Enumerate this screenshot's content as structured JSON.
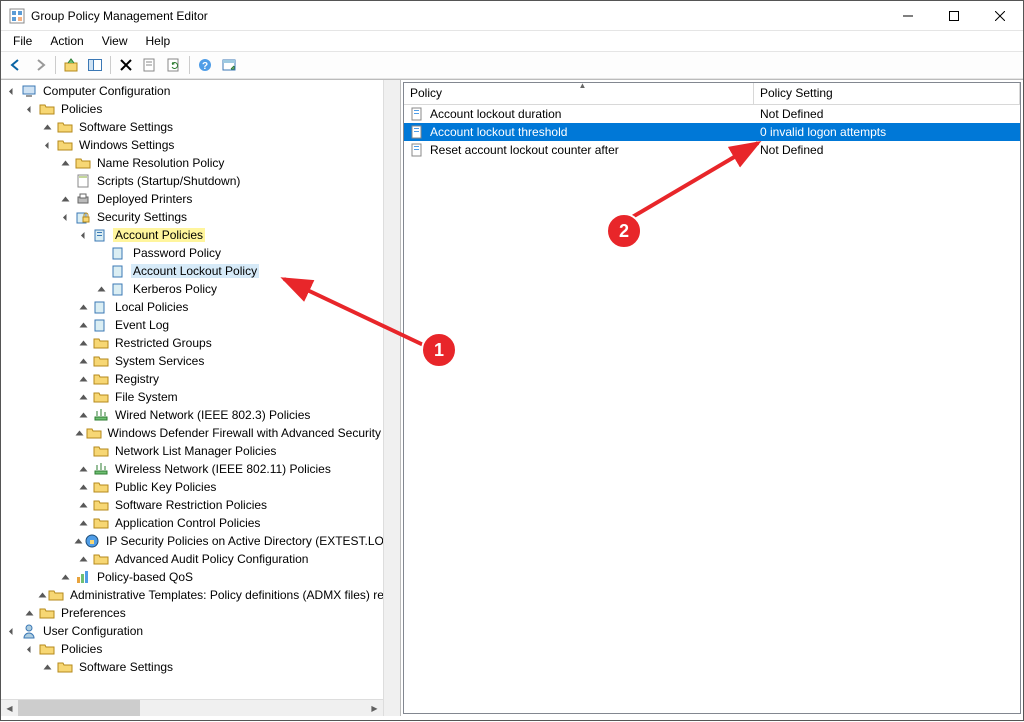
{
  "window": {
    "title": "Group Policy Management Editor"
  },
  "menus": [
    "File",
    "Action",
    "View",
    "Help"
  ],
  "tree": {
    "root": "Computer Configuration",
    "policies": "Policies",
    "software_settings": "Software Settings",
    "windows_settings": "Windows Settings",
    "name_resolution": "Name Resolution Policy",
    "scripts": "Scripts (Startup/Shutdown)",
    "deployed_printers": "Deployed Printers",
    "security_settings": "Security Settings",
    "account_policies": "Account Policies",
    "password_policy": "Password Policy",
    "account_lockout_policy": "Account Lockout Policy",
    "kerberos_policy": "Kerberos Policy",
    "local_policies": "Local Policies",
    "event_log": "Event Log",
    "restricted_groups": "Restricted Groups",
    "system_services": "System Services",
    "registry": "Registry",
    "file_system": "File System",
    "wired_network": "Wired Network (IEEE 802.3) Policies",
    "defender_firewall": "Windows Defender Firewall with Advanced Security",
    "network_list": "Network List Manager Policies",
    "wireless_network": "Wireless Network (IEEE 802.11) Policies",
    "public_key": "Public Key Policies",
    "software_restriction": "Software Restriction Policies",
    "app_control": "Application Control Policies",
    "ip_security": "IP Security Policies on Active Directory (EXTEST.LOCAL)",
    "advanced_audit": "Advanced Audit Policy Configuration",
    "policy_based_qos": "Policy-based QoS",
    "admin_templates": "Administrative Templates: Policy definitions (ADMX files) retrieved from the central store.",
    "preferences": "Preferences",
    "user_config": "User Configuration",
    "user_policies": "Policies",
    "user_software_settings": "Software Settings"
  },
  "list": {
    "headers": {
      "policy": "Policy",
      "setting": "Policy Setting"
    },
    "rows": [
      {
        "name": "Account lockout duration",
        "setting": "Not Defined"
      },
      {
        "name": "Account lockout threshold",
        "setting": "0 invalid logon attempts"
      },
      {
        "name": "Reset account lockout counter after",
        "setting": "Not Defined"
      }
    ]
  },
  "annotations": {
    "one": "1",
    "two": "2"
  }
}
